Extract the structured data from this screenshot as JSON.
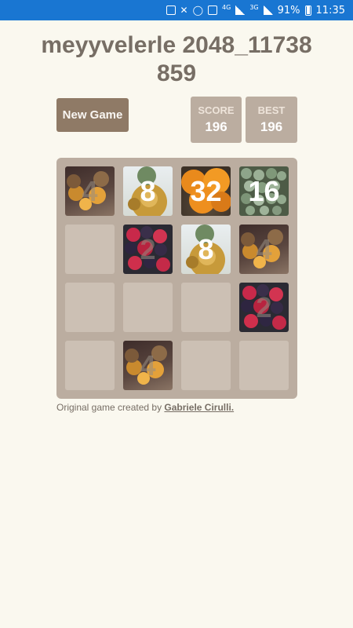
{
  "status_bar": {
    "network_1": "4G",
    "network_2": "3G",
    "battery": "91%",
    "time": "11:35"
  },
  "game": {
    "title": "meyyvelerle 2048_11738859",
    "new_game_label": "New Game",
    "score_label": "SCORE",
    "score_value": "196",
    "best_label": "BEST",
    "best_value": "196"
  },
  "board": {
    "size": 4,
    "tiles": [
      {
        "value": "4",
        "image": "physalis"
      },
      {
        "value": "8",
        "image": "pineapple"
      },
      {
        "value": "32",
        "image": "oranges"
      },
      {
        "value": "16",
        "image": "olives"
      },
      {
        "value": "",
        "image": "empty"
      },
      {
        "value": "2",
        "image": "berries"
      },
      {
        "value": "8",
        "image": "pineapple"
      },
      {
        "value": "4",
        "image": "physalis"
      },
      {
        "value": "",
        "image": "empty"
      },
      {
        "value": "",
        "image": "empty"
      },
      {
        "value": "",
        "image": "empty"
      },
      {
        "value": "2",
        "image": "berries"
      },
      {
        "value": "",
        "image": "empty"
      },
      {
        "value": "4",
        "image": "physalis"
      },
      {
        "value": "",
        "image": "empty"
      },
      {
        "value": "",
        "image": "empty"
      }
    ]
  },
  "footer": {
    "prefix": "Original game created by",
    "author": "Gabriele Cirulli."
  },
  "colors": {
    "status_bar": "#1976d2",
    "background": "#faf8ef",
    "board": "#bbada0",
    "button": "#8f7a66",
    "text": "#776e65"
  }
}
